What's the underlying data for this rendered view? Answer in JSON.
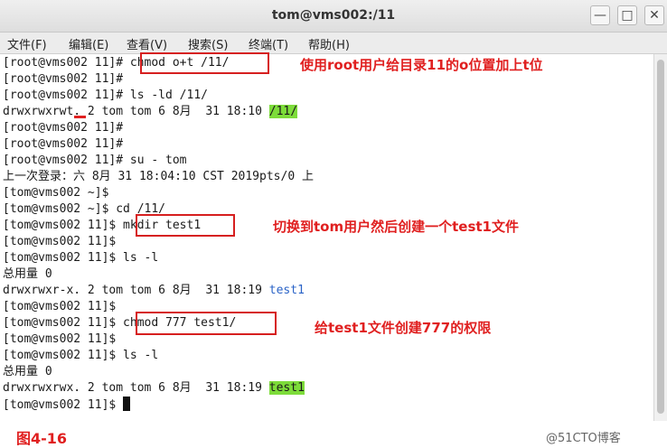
{
  "window": {
    "title": "tom@vms002:/11",
    "minimize_glyph": "—",
    "maximize_glyph": "□",
    "close_glyph": "✕"
  },
  "menu": [
    "文件(F)",
    "编辑(E)",
    "查看(V)",
    "搜索(S)",
    "终端(T)",
    "帮助(H)"
  ],
  "terminal": {
    "lines": [
      {
        "text": "[root@vms002 11]# chmod o+t /11/"
      },
      {
        "text": "[root@vms002 11]#"
      },
      {
        "text": "[root@vms002 11]# ls -ld /11/"
      },
      {
        "pre": "drwxrwxrwt. 2 tom tom 6 8月  31 18:10 ",
        "hl": "/11/"
      },
      {
        "text": "[root@vms002 11]#"
      },
      {
        "text": "[root@vms002 11]#"
      },
      {
        "text": "[root@vms002 11]# su - tom"
      },
      {
        "text": "上一次登录：六 8月 31 18:04:10 CST 2019pts/0 上"
      },
      {
        "text": "[tom@vms002 ~]$"
      },
      {
        "text": "[tom@vms002 ~]$ cd /11/"
      },
      {
        "text": "[tom@vms002 11]$ mkdir test1"
      },
      {
        "text": "[tom@vms002 11]$"
      },
      {
        "text": "[tom@vms002 11]$ ls -l"
      },
      {
        "text": "总用量 0"
      },
      {
        "pre": "drwxrwxr-x. 2 tom tom 6 8月  31 18:19 ",
        "blue": "test1"
      },
      {
        "text": "[tom@vms002 11]$"
      },
      {
        "text": "[tom@vms002 11]$ chmod 777 test1/"
      },
      {
        "text": "[tom@vms002 11]$"
      },
      {
        "text": "[tom@vms002 11]$ ls -l"
      },
      {
        "text": "总用量 0"
      },
      {
        "pre": "drwxrwxrwx. 2 tom tom 6 8月  31 18:19 ",
        "hl": "test1"
      },
      {
        "text": "[tom@vms002 11]$ ",
        "cursor": true
      }
    ]
  },
  "annotations": {
    "note1": "使用root用户给目录11的o位置加上t位",
    "note2": "切换到tom用户然后创建一个test1文件",
    "note3": "给test1文件创建777的权限",
    "colors": {
      "annotation": "#e02020",
      "highlight": "#7ddc3a",
      "dir": "#2a63c7"
    }
  },
  "footer": {
    "figure_label": "图4-16",
    "watermark": "@51CTO博客"
  }
}
